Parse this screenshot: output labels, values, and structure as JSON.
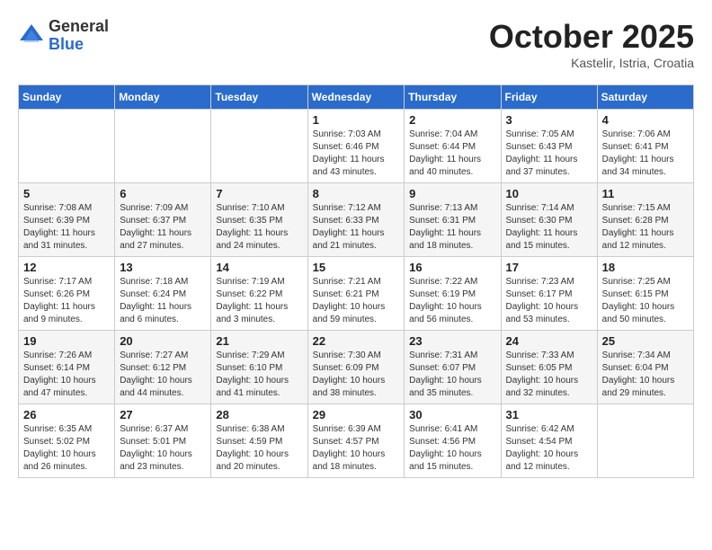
{
  "logo": {
    "general": "General",
    "blue": "Blue"
  },
  "header": {
    "month": "October 2025",
    "location": "Kastelir, Istria, Croatia"
  },
  "weekdays": [
    "Sunday",
    "Monday",
    "Tuesday",
    "Wednesday",
    "Thursday",
    "Friday",
    "Saturday"
  ],
  "weeks": [
    [
      {
        "day": "",
        "info": ""
      },
      {
        "day": "",
        "info": ""
      },
      {
        "day": "",
        "info": ""
      },
      {
        "day": "1",
        "info": "Sunrise: 7:03 AM\nSunset: 6:46 PM\nDaylight: 11 hours\nand 43 minutes."
      },
      {
        "day": "2",
        "info": "Sunrise: 7:04 AM\nSunset: 6:44 PM\nDaylight: 11 hours\nand 40 minutes."
      },
      {
        "day": "3",
        "info": "Sunrise: 7:05 AM\nSunset: 6:43 PM\nDaylight: 11 hours\nand 37 minutes."
      },
      {
        "day": "4",
        "info": "Sunrise: 7:06 AM\nSunset: 6:41 PM\nDaylight: 11 hours\nand 34 minutes."
      }
    ],
    [
      {
        "day": "5",
        "info": "Sunrise: 7:08 AM\nSunset: 6:39 PM\nDaylight: 11 hours\nand 31 minutes."
      },
      {
        "day": "6",
        "info": "Sunrise: 7:09 AM\nSunset: 6:37 PM\nDaylight: 11 hours\nand 27 minutes."
      },
      {
        "day": "7",
        "info": "Sunrise: 7:10 AM\nSunset: 6:35 PM\nDaylight: 11 hours\nand 24 minutes."
      },
      {
        "day": "8",
        "info": "Sunrise: 7:12 AM\nSunset: 6:33 PM\nDaylight: 11 hours\nand 21 minutes."
      },
      {
        "day": "9",
        "info": "Sunrise: 7:13 AM\nSunset: 6:31 PM\nDaylight: 11 hours\nand 18 minutes."
      },
      {
        "day": "10",
        "info": "Sunrise: 7:14 AM\nSunset: 6:30 PM\nDaylight: 11 hours\nand 15 minutes."
      },
      {
        "day": "11",
        "info": "Sunrise: 7:15 AM\nSunset: 6:28 PM\nDaylight: 11 hours\nand 12 minutes."
      }
    ],
    [
      {
        "day": "12",
        "info": "Sunrise: 7:17 AM\nSunset: 6:26 PM\nDaylight: 11 hours\nand 9 minutes."
      },
      {
        "day": "13",
        "info": "Sunrise: 7:18 AM\nSunset: 6:24 PM\nDaylight: 11 hours\nand 6 minutes."
      },
      {
        "day": "14",
        "info": "Sunrise: 7:19 AM\nSunset: 6:22 PM\nDaylight: 11 hours\nand 3 minutes."
      },
      {
        "day": "15",
        "info": "Sunrise: 7:21 AM\nSunset: 6:21 PM\nDaylight: 10 hours\nand 59 minutes."
      },
      {
        "day": "16",
        "info": "Sunrise: 7:22 AM\nSunset: 6:19 PM\nDaylight: 10 hours\nand 56 minutes."
      },
      {
        "day": "17",
        "info": "Sunrise: 7:23 AM\nSunset: 6:17 PM\nDaylight: 10 hours\nand 53 minutes."
      },
      {
        "day": "18",
        "info": "Sunrise: 7:25 AM\nSunset: 6:15 PM\nDaylight: 10 hours\nand 50 minutes."
      }
    ],
    [
      {
        "day": "19",
        "info": "Sunrise: 7:26 AM\nSunset: 6:14 PM\nDaylight: 10 hours\nand 47 minutes."
      },
      {
        "day": "20",
        "info": "Sunrise: 7:27 AM\nSunset: 6:12 PM\nDaylight: 10 hours\nand 44 minutes."
      },
      {
        "day": "21",
        "info": "Sunrise: 7:29 AM\nSunset: 6:10 PM\nDaylight: 10 hours\nand 41 minutes."
      },
      {
        "day": "22",
        "info": "Sunrise: 7:30 AM\nSunset: 6:09 PM\nDaylight: 10 hours\nand 38 minutes."
      },
      {
        "day": "23",
        "info": "Sunrise: 7:31 AM\nSunset: 6:07 PM\nDaylight: 10 hours\nand 35 minutes."
      },
      {
        "day": "24",
        "info": "Sunrise: 7:33 AM\nSunset: 6:05 PM\nDaylight: 10 hours\nand 32 minutes."
      },
      {
        "day": "25",
        "info": "Sunrise: 7:34 AM\nSunset: 6:04 PM\nDaylight: 10 hours\nand 29 minutes."
      }
    ],
    [
      {
        "day": "26",
        "info": "Sunrise: 6:35 AM\nSunset: 5:02 PM\nDaylight: 10 hours\nand 26 minutes."
      },
      {
        "day": "27",
        "info": "Sunrise: 6:37 AM\nSunset: 5:01 PM\nDaylight: 10 hours\nand 23 minutes."
      },
      {
        "day": "28",
        "info": "Sunrise: 6:38 AM\nSunset: 4:59 PM\nDaylight: 10 hours\nand 20 minutes."
      },
      {
        "day": "29",
        "info": "Sunrise: 6:39 AM\nSunset: 4:57 PM\nDaylight: 10 hours\nand 18 minutes."
      },
      {
        "day": "30",
        "info": "Sunrise: 6:41 AM\nSunset: 4:56 PM\nDaylight: 10 hours\nand 15 minutes."
      },
      {
        "day": "31",
        "info": "Sunrise: 6:42 AM\nSunset: 4:54 PM\nDaylight: 10 hours\nand 12 minutes."
      },
      {
        "day": "",
        "info": ""
      }
    ]
  ]
}
